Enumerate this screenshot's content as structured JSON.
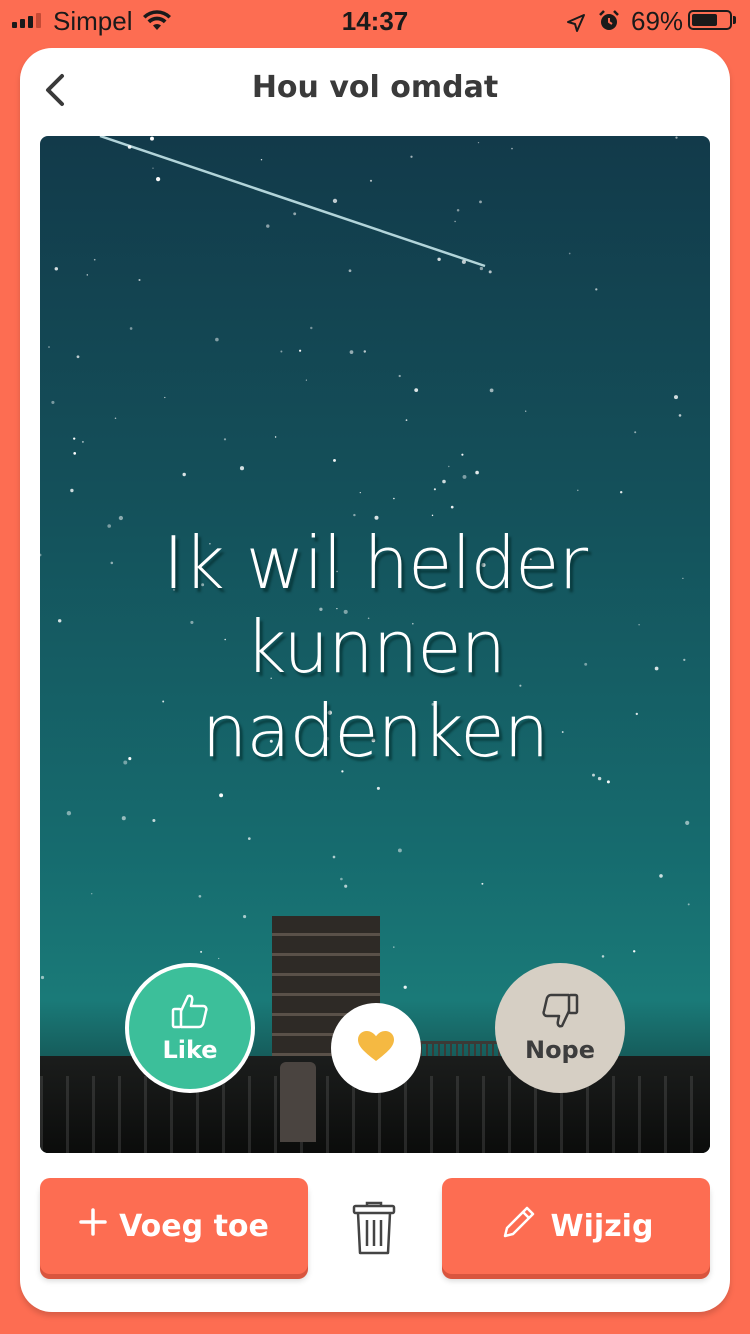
{
  "status_bar": {
    "carrier": "Simpel",
    "time": "14:37",
    "battery_percent_text": "69%",
    "battery_level": 0.69
  },
  "header": {
    "title": "Hou vol omdat"
  },
  "card": {
    "quote_line1": "Ik wil helder",
    "quote_line2": "kunnen",
    "quote_line3": "nadenken"
  },
  "actions": {
    "like_label": "Like",
    "nope_label": "Nope",
    "add_label": "Voeg toe",
    "edit_label": "Wijzig"
  },
  "colors": {
    "background": "#fd6d52",
    "like": "#3cbf9a",
    "nope": "#d6cfc4",
    "heart": "#f5b942",
    "button": "#fd6d52"
  },
  "icons": {
    "back": "chevron-left-icon",
    "like": "thumbs-up-icon",
    "favorite": "heart-icon",
    "nope": "thumbs-down-icon",
    "add": "plus-icon",
    "delete": "trash-icon",
    "edit": "pencil-icon"
  }
}
